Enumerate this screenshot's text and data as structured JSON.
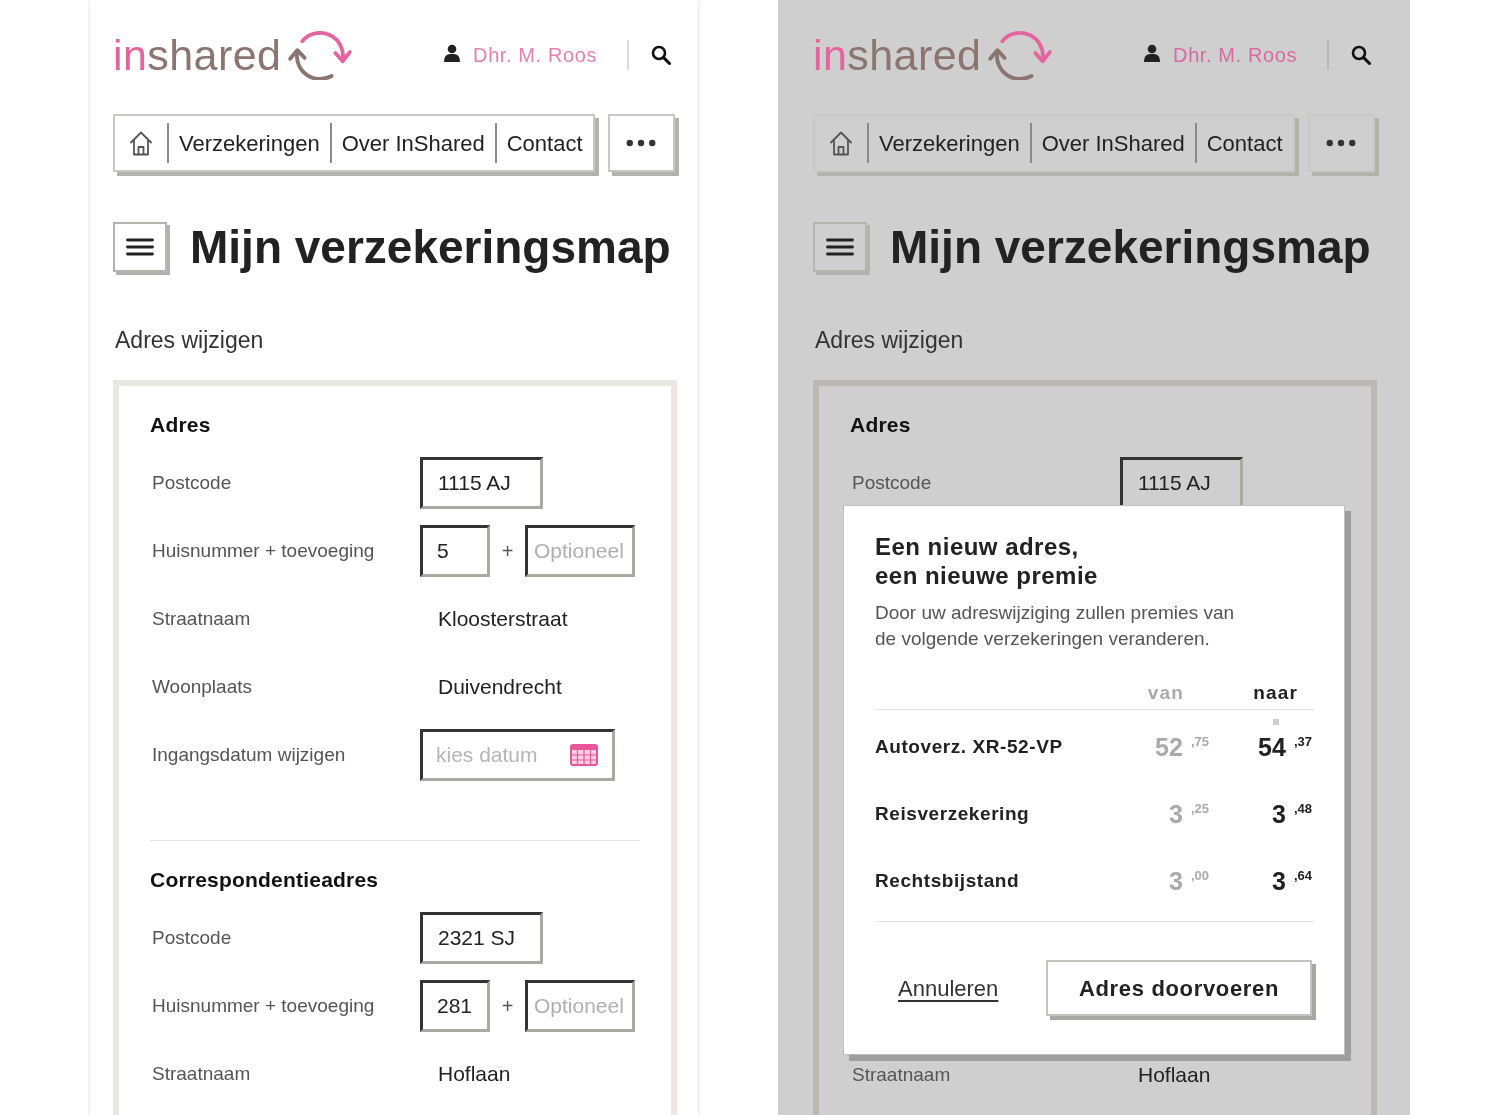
{
  "screens": [
    {
      "dimmed": false,
      "header": {
        "logo": {
          "accent": "in",
          "rest": "shared"
        },
        "user": "Dhr. M. Roos"
      },
      "nav": [
        {
          "kind": "home"
        },
        {
          "kind": "link",
          "label": "Verzekeringen"
        },
        {
          "kind": "link",
          "label": "Over InShared"
        },
        {
          "kind": "link",
          "label": "Contact"
        }
      ],
      "page_title": "Mijn verzekeringsmap",
      "subtitle": "Adres wijzigen",
      "form": {
        "sections": [
          {
            "heading": "Adres",
            "rows": [
              {
                "label": "Postcode",
                "kind": "input",
                "value": "1115 AJ"
              },
              {
                "label": "Huisnummer + toevoeging",
                "kind": "house_number",
                "value": "5",
                "joiner": "+",
                "placeholder": "Optioneel"
              },
              {
                "label": "Straatnaam",
                "kind": "text",
                "value": "Kloosterstraat"
              },
              {
                "label": "Woonplaats",
                "kind": "text",
                "value": "Duivendrecht"
              },
              {
                "label": "Ingangsdatum wijzigen",
                "kind": "date",
                "placeholder": "kies datum"
              }
            ]
          },
          {
            "heading": "Correspondentieadres",
            "rows": [
              {
                "label": "Postcode",
                "kind": "input",
                "value": "2321 SJ"
              },
              {
                "label": "Huisnummer + toevoeging",
                "kind": "house_number",
                "value": "281",
                "joiner": "+",
                "placeholder": "Optioneel"
              },
              {
                "label": "Straatnaam",
                "kind": "text",
                "value": "Hoflaan"
              }
            ]
          }
        ]
      }
    },
    {
      "dimmed": true,
      "header": {
        "logo": {
          "accent": "in",
          "rest": "shared"
        },
        "user": "Dhr. M. Roos"
      },
      "nav": [
        {
          "kind": "home"
        },
        {
          "kind": "link",
          "label": "Verzekeringen"
        },
        {
          "kind": "link",
          "label": "Over InShared"
        },
        {
          "kind": "link",
          "label": "Contact"
        }
      ],
      "page_title": "Mijn verzekeringsmap",
      "subtitle": "Adres wijzigen",
      "form": {
        "sections": [
          {
            "heading": "Adres",
            "rows": [
              {
                "label": "Postcode",
                "kind": "input",
                "value": "1115 AJ"
              }
            ]
          },
          {
            "rows": [
              {
                "label": "Straatnaam",
                "kind": "text",
                "value": "Hoflaan"
              }
            ]
          }
        ]
      },
      "dialog": {
        "title": "Een nieuw adres,\neen nieuwe premie",
        "body": "Door uw adreswijziging zullen premies van de volgende verzekeringen veranderen.",
        "columns": [
          "van",
          "naar"
        ],
        "rows": [
          {
            "name": "Autoverz. XR-52-VP",
            "from": "52$^{,75}$",
            "to": "54$^{,37}$"
          },
          {
            "name": "Reisverzekering",
            "from": "3$^{,25}$",
            "to": "3$^{,48}$"
          },
          {
            "name": "Rechtsbijstand",
            "from": "3$^{,00}$",
            "to": "3$^{,64}$"
          }
        ],
        "actions": [
          {
            "kind": "link",
            "label": "Annuleren"
          },
          {
            "kind": "button",
            "label": "Adres doorvoeren"
          }
        ]
      }
    }
  ]
}
